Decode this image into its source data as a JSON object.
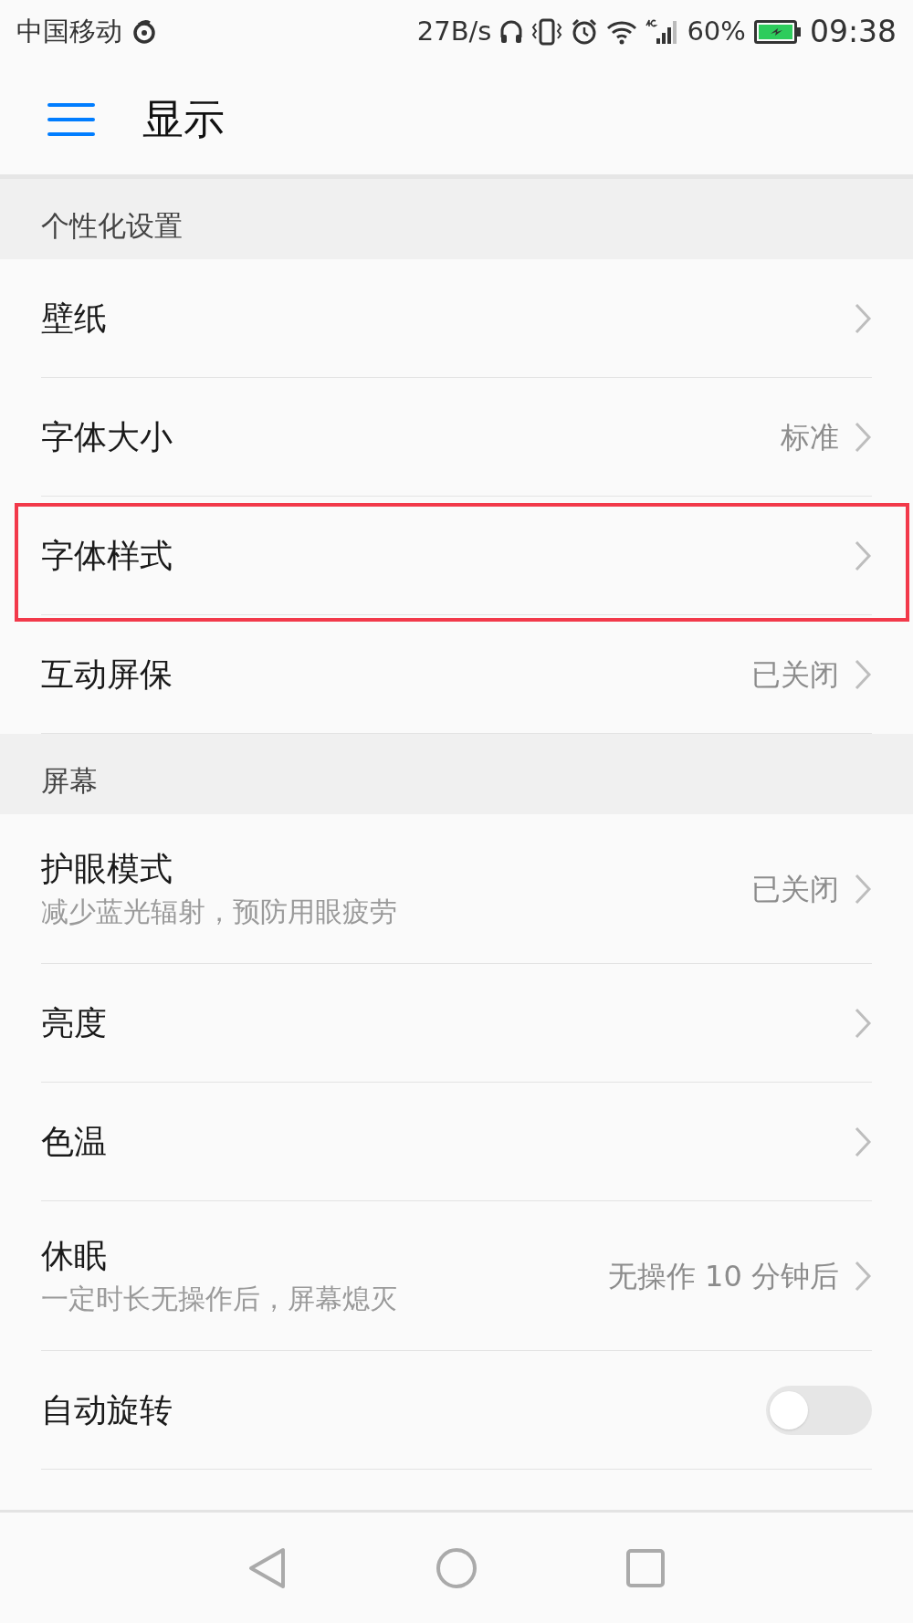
{
  "status_bar": {
    "carrier": "中国移动",
    "speed": "27B/s",
    "battery": "60%",
    "time": "09:38"
  },
  "header": {
    "title": "显示"
  },
  "sections": [
    {
      "title": "个性化设置",
      "items": [
        {
          "kind": "link",
          "title": "壁纸",
          "highlighted": false
        },
        {
          "kind": "link",
          "title": "字体大小",
          "value": "标准",
          "highlighted": false
        },
        {
          "kind": "link",
          "title": "字体样式",
          "highlighted": true
        },
        {
          "kind": "link",
          "title": "互动屏保",
          "value": "已关闭",
          "highlighted": false
        }
      ]
    },
    {
      "title": "屏幕",
      "items": [
        {
          "kind": "link",
          "title": "护眼模式",
          "subtitle": "减少蓝光辐射，预防用眼疲劳",
          "value": "已关闭",
          "highlighted": false
        },
        {
          "kind": "link",
          "title": "亮度",
          "highlighted": false
        },
        {
          "kind": "link",
          "title": "色温",
          "highlighted": false
        },
        {
          "kind": "link",
          "title": "休眠",
          "subtitle": "一定时长无操作后，屏幕熄灭",
          "value": "无操作 10 分钟后",
          "highlighted": false
        },
        {
          "kind": "toggle",
          "title": "自动旋转",
          "on": false,
          "highlighted": false
        }
      ]
    }
  ]
}
